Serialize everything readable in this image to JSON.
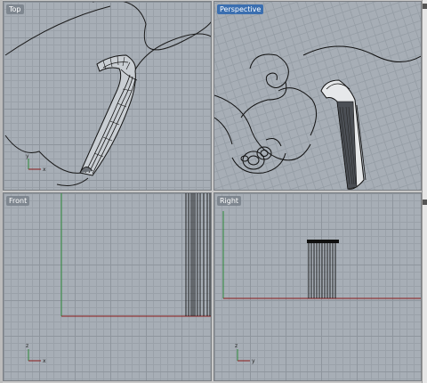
{
  "viewports": {
    "top": {
      "title": "Top",
      "axis_y": "y",
      "axis_x": "x"
    },
    "perspective": {
      "title": "Perspective"
    },
    "front": {
      "title": "Front",
      "axis_z": "z",
      "axis_x": "x"
    },
    "right": {
      "title": "Right",
      "axis_z": "z",
      "axis_y": "y"
    }
  },
  "colors": {
    "viewport_bg": "#a7aeb6",
    "active_title": "#3b6fb0",
    "x_axis": "#8b1a1a",
    "y_axis": "#2e8b3a"
  }
}
